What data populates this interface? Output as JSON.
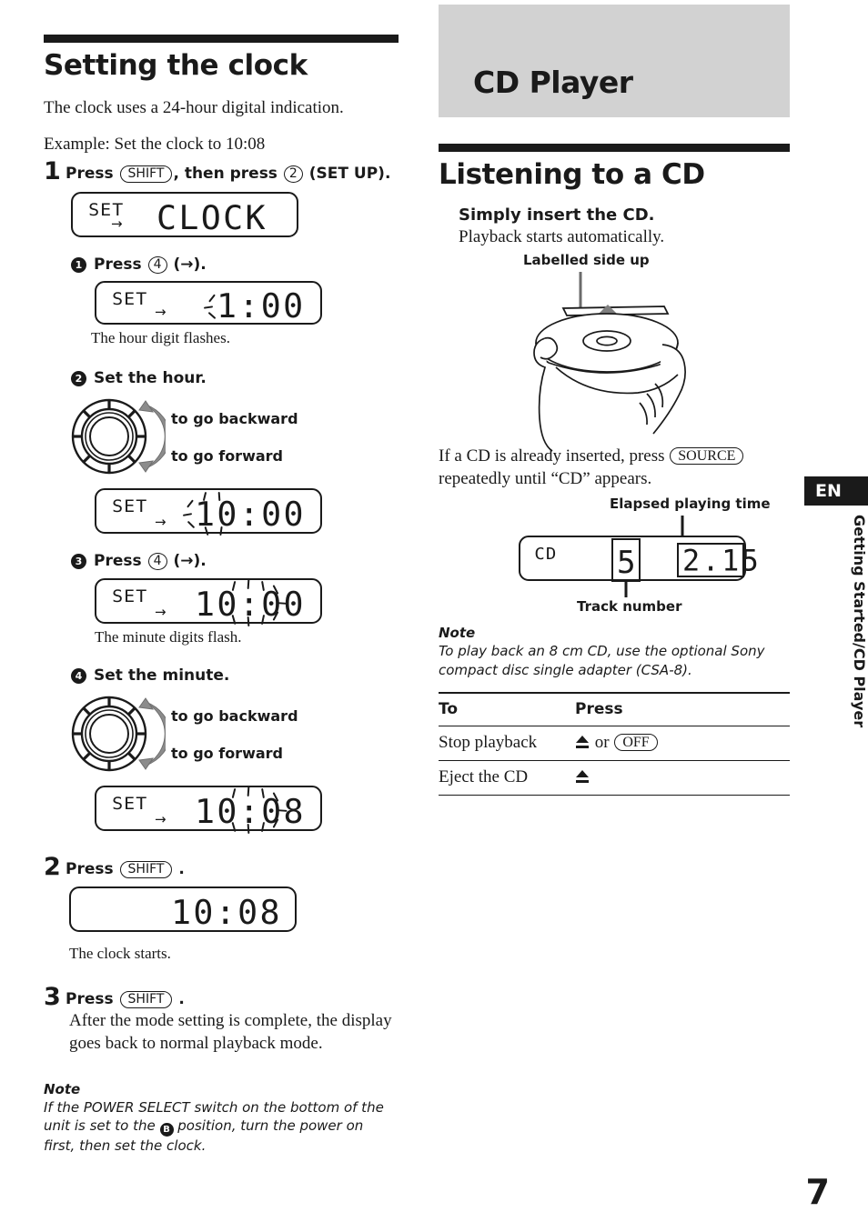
{
  "page": {
    "number": "7",
    "language_tab": "EN",
    "running_head": "Getting Started/CD Player"
  },
  "left_column": {
    "heading": "Setting the clock",
    "intro": "The clock uses a 24-hour digital indication.",
    "example_line": "Example: Set the clock to 10:08",
    "step1": {
      "number": "1",
      "text_a": "Press",
      "button_shift": "SHIFT",
      "text_b": ", then press",
      "button_2": "2",
      "text_c": "(SET UP)."
    },
    "display1": {
      "set": "SET",
      "value": "CLOCK",
      "arrow": "→"
    },
    "substep1": {
      "bullet": "1",
      "text_a": "Press",
      "button_4": "4",
      "text_b": "(→).",
      "display": {
        "set": "SET",
        "value": "1:00",
        "arrow": "→"
      },
      "caption": "The hour digit flashes."
    },
    "substep2": {
      "bullet": "2",
      "text": "Set the hour.",
      "knob_backward": "to go backward",
      "knob_forward": "to go forward",
      "display": {
        "set": "SET",
        "value": "10:00",
        "arrow": "→"
      }
    },
    "substep3": {
      "bullet": "3",
      "text_a": "Press",
      "button_4": "4",
      "text_b": "(→).",
      "display": {
        "set": "SET",
        "value": "10:00",
        "arrow": "→"
      },
      "caption": "The minute digits flash."
    },
    "substep4": {
      "bullet": "4",
      "text": "Set the minute.",
      "knob_backward": "to go backward",
      "knob_forward": "to go forward",
      "display": {
        "set": "SET",
        "value": "10:08",
        "arrow": "→"
      }
    },
    "step2": {
      "number": "2",
      "text_a": "Press",
      "button_shift": "SHIFT",
      "text_b": ".",
      "display": {
        "value": "10:08"
      },
      "caption": "The clock starts."
    },
    "step3": {
      "number": "3",
      "text_a": "Press",
      "button_shift": "SHIFT",
      "text_b": ".",
      "body": "After the mode setting is complete, the display goes back to normal playback mode."
    },
    "note": {
      "label": "Note",
      "text_a": "If the POWER SELECT switch on the bottom of the unit is set to the",
      "badge": "B",
      "text_b": "position, turn the power on first, then set the clock."
    }
  },
  "right_column": {
    "chapter_title": "CD Player",
    "heading": "Listening to a CD",
    "insert_bold": "Simply insert the CD.",
    "insert_sub": "Playback starts automatically.",
    "callout_labelled_side": "Labelled side up",
    "source_line_a": "If a CD is already inserted, press",
    "source_button": "SOURCE",
    "source_line_b": "repeatedly until “CD” appears.",
    "callout_elapsed": "Elapsed playing time",
    "callout_track": "Track number",
    "display": {
      "mode": "CD",
      "track": "5",
      "time": "2.15"
    },
    "note": {
      "label": "Note",
      "text": "To play back an 8 cm CD, use the optional Sony compact disc single adapter (CSA-8)."
    },
    "table": {
      "headers": [
        "To",
        "Press"
      ],
      "rows": [
        {
          "to": "Stop playback",
          "press_icon": "eject-icon",
          "press_mid": "or",
          "press_button": "OFF"
        },
        {
          "to": "Eject the CD",
          "press_icon": "eject-icon",
          "press_mid": "",
          "press_button": ""
        }
      ]
    }
  },
  "colors": {
    "ink": "#1a1a1a",
    "banner_grey": "#d2d2d2",
    "arrow_grey": "#8c8c8c"
  }
}
